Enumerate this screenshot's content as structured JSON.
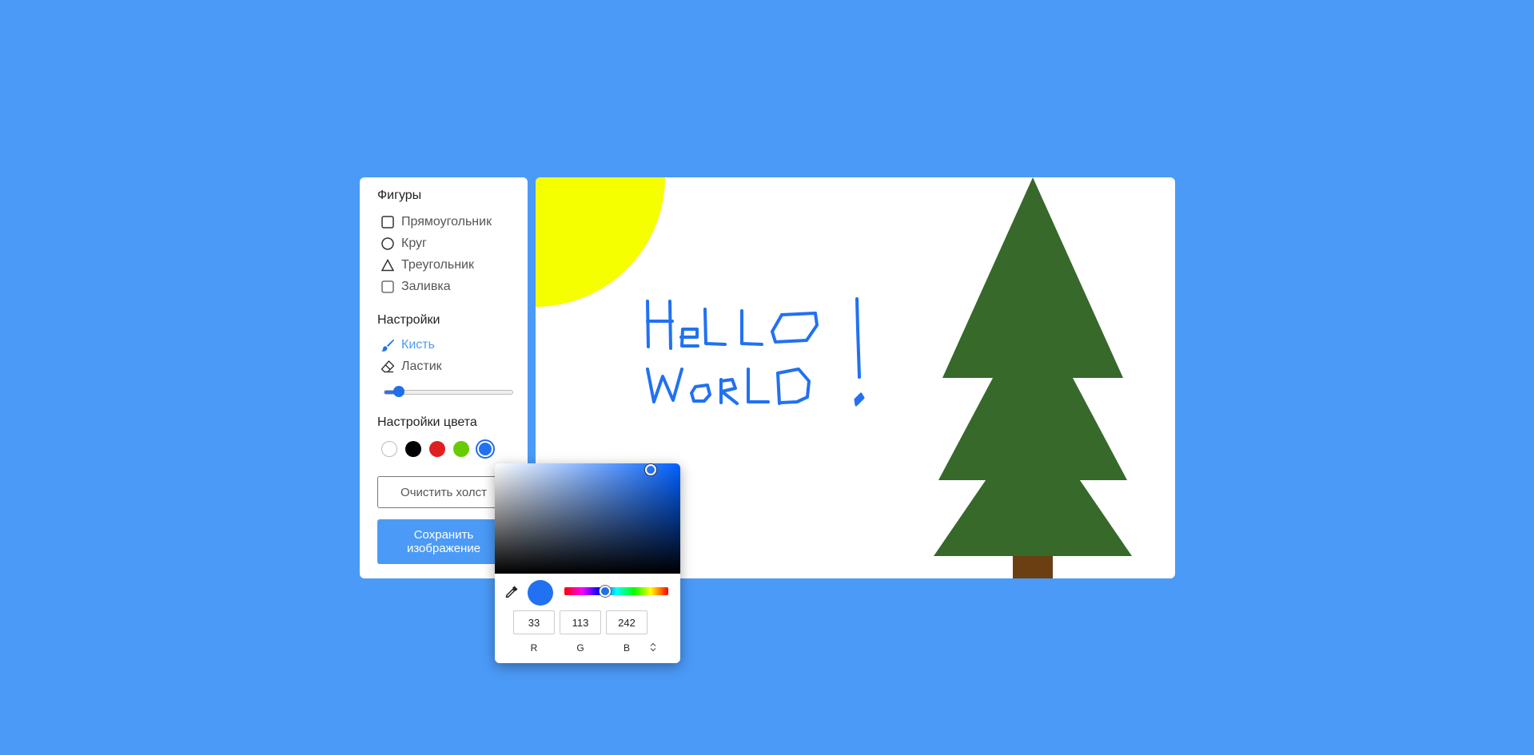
{
  "toolbar": {
    "shapes_title": "Фигуры",
    "shapes": [
      {
        "label": "Прямоугольник",
        "icon": "square-icon"
      },
      {
        "label": "Круг",
        "icon": "circle-icon"
      },
      {
        "label": "Треугольник",
        "icon": "triangle-icon"
      },
      {
        "label": "Заливка",
        "icon": "checkbox-icon"
      }
    ],
    "settings_title": "Настройки",
    "tools": [
      {
        "label": "Кисть",
        "icon": "brush-icon",
        "active": true
      },
      {
        "label": "Ластик",
        "icon": "eraser-icon",
        "active": false
      }
    ],
    "brush_size_level": 0.11,
    "color_title": "Настройки цвета",
    "swatches": [
      "#ffffff",
      "#000000",
      "#e02020",
      "#66cc00",
      "#2171f2"
    ],
    "selected_swatch": 4,
    "clear_label": "Очистить холст",
    "save_label": "Сохранить изображение"
  },
  "canvas": {
    "text_line1": "HeLLO",
    "text_line2": "WORLD!",
    "sun_color": "#f6ff00",
    "tree_color": "#36692a",
    "trunk_color": "#6b3f12",
    "ink_color": "#2171f2"
  },
  "color_picker": {
    "r": "33",
    "g": "113",
    "b": "242",
    "label_r": "R",
    "label_g": "G",
    "label_b": "B",
    "hue_level": 0.39,
    "current_color": "#2171f2"
  }
}
